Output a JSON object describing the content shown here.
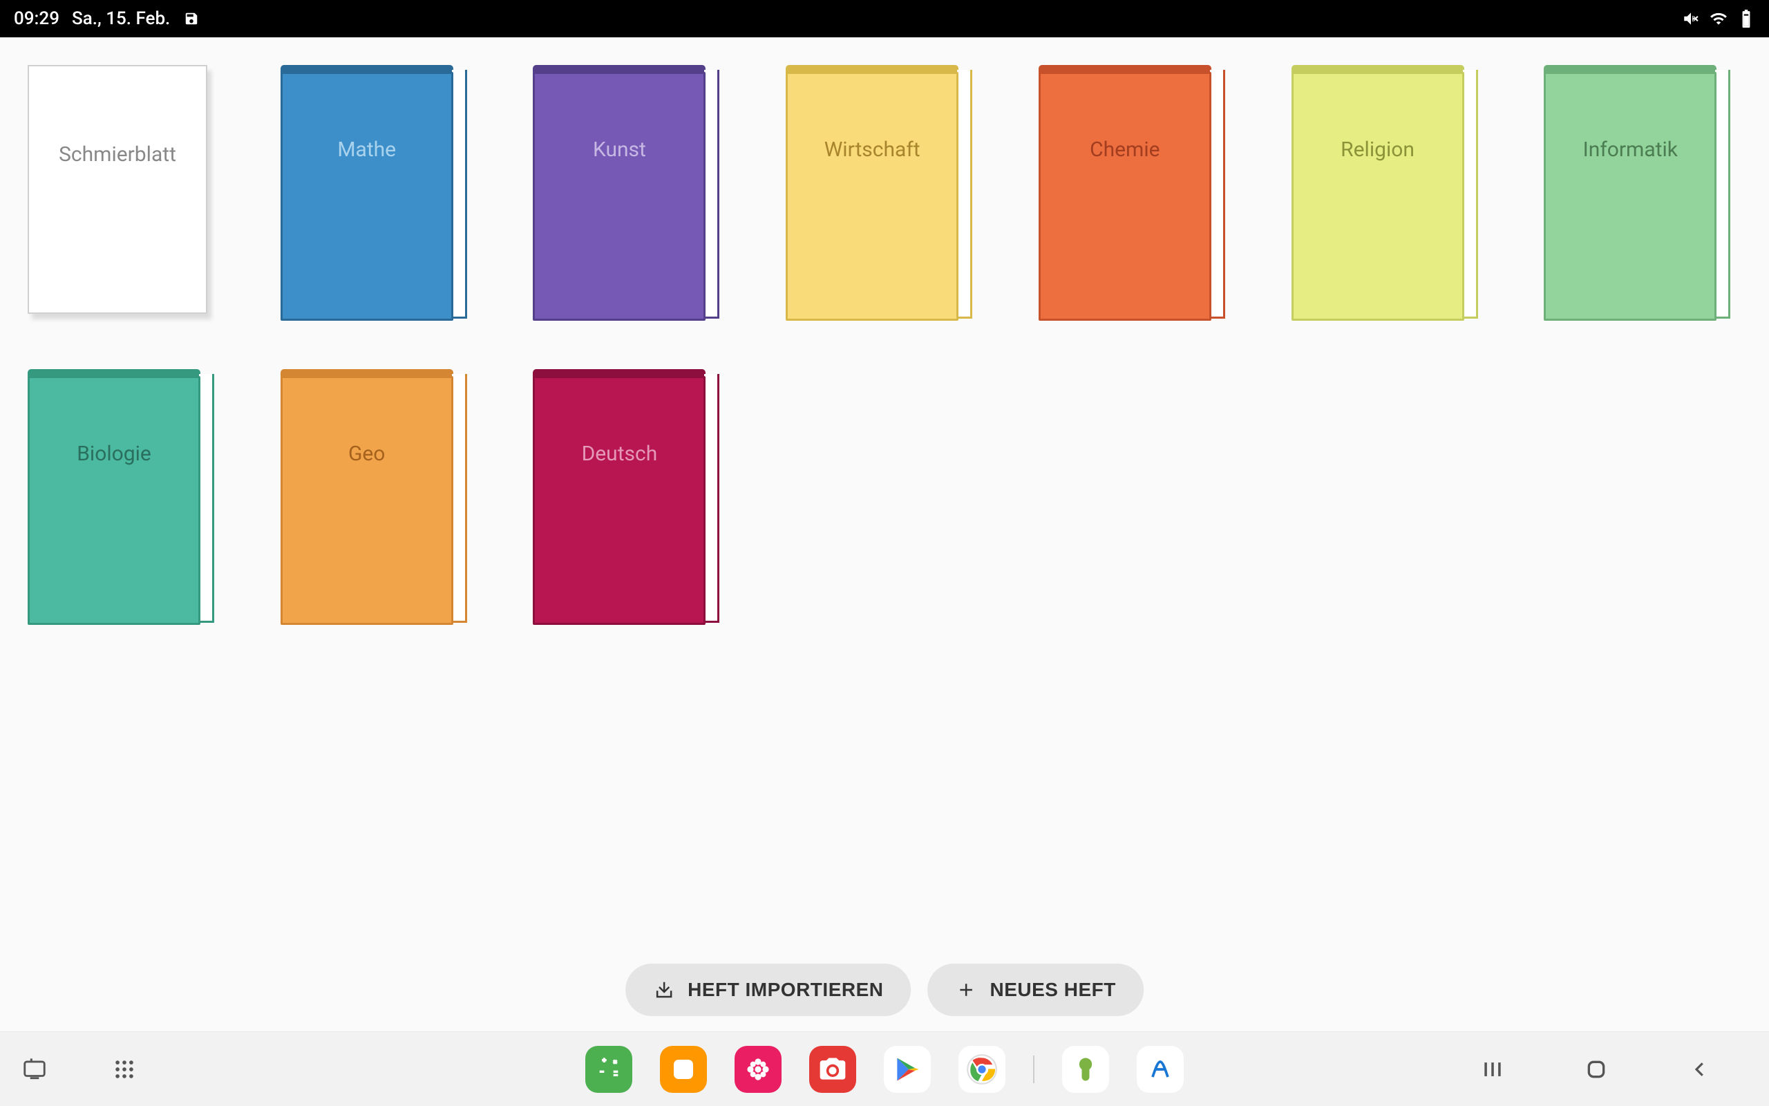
{
  "status": {
    "time": "09:29",
    "date": "Sa., 15. Feb."
  },
  "books": [
    {
      "label": "Schmierblatt",
      "type": "paper",
      "bg": "#ffffff",
      "border": "#d0d0d0",
      "text": "#888888"
    },
    {
      "label": "Mathe",
      "type": "book",
      "bg": "#3d8fc9",
      "border": "#2a6a99",
      "text": "#a9d3ed"
    },
    {
      "label": "Kunst",
      "type": "book",
      "bg": "#7659b5",
      "border": "#54408a",
      "text": "#c6b7e3"
    },
    {
      "label": "Wirtschaft",
      "type": "book",
      "bg": "#f9db79",
      "border": "#d9b84a",
      "text": "#a8852d"
    },
    {
      "label": "Chemie",
      "type": "book",
      "bg": "#ed6f3f",
      "border": "#c7512a",
      "text": "#a23e1f"
    },
    {
      "label": "Religion",
      "type": "book",
      "bg": "#e6ed83",
      "border": "#c5cd5e",
      "text": "#8c9238"
    },
    {
      "label": "Informatik",
      "type": "book",
      "bg": "#92d49b",
      "border": "#6db079",
      "text": "#4c7d52"
    },
    {
      "label": "Biologie",
      "type": "book",
      "bg": "#4bbaa0",
      "border": "#359980",
      "text": "#2a6f5e"
    },
    {
      "label": "Geo",
      "type": "book",
      "bg": "#f2a44b",
      "border": "#d48633",
      "text": "#a5621d"
    },
    {
      "label": "Deutsch",
      "type": "book",
      "bg": "#b71651",
      "border": "#8c0f3d",
      "text": "#e598b7"
    }
  ],
  "actions": {
    "import_label": "HEFT IMPORTIEREN",
    "new_label": "NEUES HEFT"
  },
  "dock": {
    "app1": "calculator",
    "app2": "gallery",
    "app3": "flower-app",
    "app4": "camera",
    "app5": "play-store",
    "app6": "chrome",
    "app7": "green-app",
    "app8": "handwriting-app"
  }
}
